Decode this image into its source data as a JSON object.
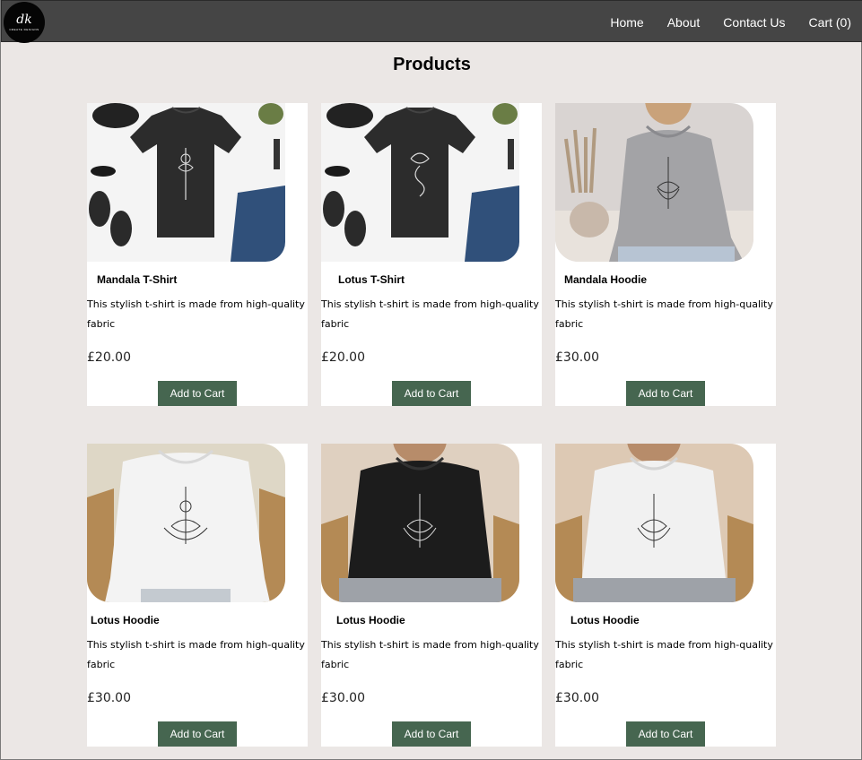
{
  "header": {
    "logo_text": "dk",
    "logo_subtext": "CREATE DESIGNS",
    "nav": [
      "Home",
      "About",
      "Contact Us",
      "Cart (0)"
    ]
  },
  "page_title": "Products",
  "products": [
    {
      "name": "Mandala T-Shirt",
      "description": "This stylish t-shirt is made from high-quality fabric",
      "price": "£20.00",
      "button": "Add to Cart",
      "image": "black-tshirt-flatlay-mandala"
    },
    {
      "name": "Lotus T-Shirt",
      "description": "This stylish t-shirt is made from high-quality fabric",
      "price": "£20.00",
      "button": "Add to Cart",
      "image": "black-tshirt-flatlay-lotus"
    },
    {
      "name": "Mandala Hoodie",
      "description": "This stylish t-shirt is made from high-quality fabric",
      "price": "£30.00",
      "button": "Add to Cart",
      "image": "grey-hoodie-model"
    },
    {
      "name": "Lotus Hoodie",
      "description": "This stylish t-shirt is made from high-quality fabric",
      "price": "£30.00",
      "button": "Add to Cart",
      "image": "white-hoodie-model-om"
    },
    {
      "name": "Lotus Hoodie",
      "description": "This stylish t-shirt is made from high-quality fabric",
      "price": "£30.00",
      "button": "Add to Cart",
      "image": "black-hoodie-model"
    },
    {
      "name": "Lotus Hoodie",
      "description": "This stylish t-shirt is made from high-quality fabric",
      "price": "£30.00",
      "button": "Add to Cart",
      "image": "white-hoodie-model-moon"
    }
  ],
  "colors": {
    "navbar": "#454545",
    "page_background": "#ebe7e5",
    "button": "#466650"
  }
}
